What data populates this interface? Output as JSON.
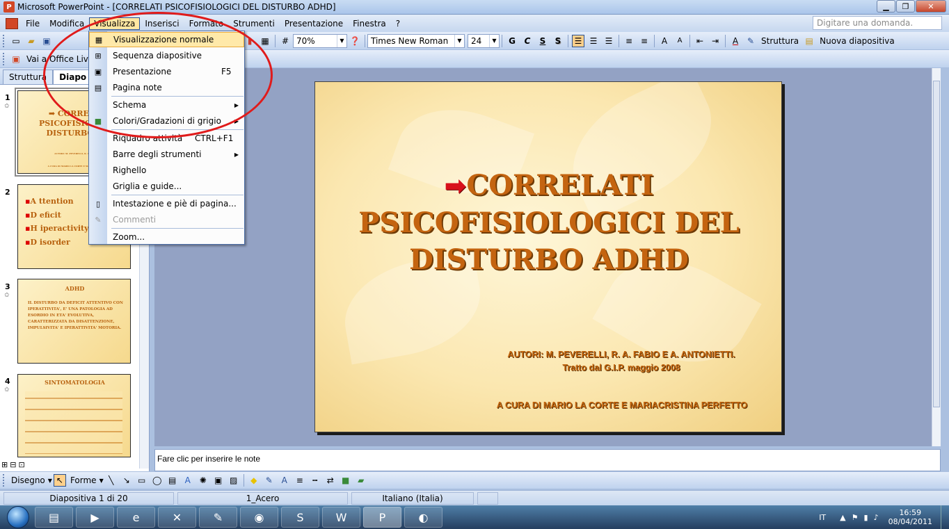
{
  "window": {
    "title": "Microsoft PowerPoint - [CORRELATI PSICOFISIOLOGICI DEL DISTURBO ADHD]",
    "minimize": "▁",
    "restore": "❐",
    "close": "✕"
  },
  "menubar": {
    "items": [
      "File",
      "Modifica",
      "Visualizza",
      "Inserisci",
      "Formato",
      "Strumenti",
      "Presentazione",
      "Finestra",
      "?"
    ],
    "help_placeholder": "Digitare una domanda."
  },
  "toolbar_standard": {
    "zoom": "70%",
    "font_name": "Times New Roman",
    "font_size": "24",
    "bold": "G",
    "italic": "C",
    "underline": "S",
    "shadow": "S",
    "structure_label": "Struttura",
    "new_slide_label": "Nuova diapositiva"
  },
  "toolbar_web": {
    "office_live": "Vai a Office Live"
  },
  "left_panel": {
    "tabs": [
      "Struttura",
      "Diapo"
    ],
    "thumbs": [
      {
        "num": "1",
        "title": "➡ CORRELA PSICOFISIOLOG DISTURBO A",
        "sub1": "AUTORI: M. PEVERELLI, R. A. FABIO E A. ANTONIETTI",
        "sub2": "A CURA DI MARIO LA CORTE E MARIACRISTINA PERFETTO"
      },
      {
        "num": "2",
        "lines": [
          "A ttention",
          "D eficit",
          "H iperactivity",
          "D isorder"
        ]
      },
      {
        "num": "3",
        "title": "ADHD",
        "text": "IL DISTURBO DA DEFICIT ATTENTIVO CON IPERATTIVITA', E' UNA PATOLOGIA AD ESORDIO IN ETA' EVOLUTIVA, CARATTERIZZATA DA DISATTENZIONE, IMPULSIVITA' E IPERATTIVITA' MOTORIA."
      },
      {
        "num": "4",
        "title": "SINTOMATOLOGIA"
      }
    ]
  },
  "view_menu": {
    "items": [
      {
        "label": "Visualizzazione normale",
        "shortcut": "",
        "icon": "normal-view-icon"
      },
      {
        "label": "Sequenza diapositive",
        "shortcut": "",
        "icon": "slide-sorter-icon"
      },
      {
        "label": "Presentazione",
        "shortcut": "F5",
        "icon": "slideshow-icon"
      },
      {
        "label": "Pagina note",
        "shortcut": "",
        "icon": "notes-page-icon"
      },
      {
        "label": "Schema",
        "shortcut": "",
        "icon": ""
      },
      {
        "label": "Colori/Gradazioni di grigio",
        "shortcut": "",
        "icon": "color-icon"
      },
      {
        "label": "Riquadro attività",
        "shortcut": "CTRL+F1",
        "icon": ""
      },
      {
        "label": "Barre degli strumenti",
        "shortcut": "",
        "icon": ""
      },
      {
        "label": "Righello",
        "shortcut": "",
        "icon": ""
      },
      {
        "label": "Griglia e guide...",
        "shortcut": "",
        "icon": ""
      },
      {
        "label": "Intestazione e piè di pagina...",
        "shortcut": "",
        "icon": "header-footer-icon"
      },
      {
        "label": "Commenti",
        "shortcut": "",
        "icon": "comments-icon"
      },
      {
        "label": "Zoom...",
        "shortcut": "",
        "icon": ""
      }
    ]
  },
  "slide": {
    "title_line1": "CORRELATI",
    "title_line2": "PSICOFISIOLOGICI DEL",
    "title_line3": "DISTURBO ADHD",
    "arrow": "➡",
    "authors_line1": "AUTORI: M. PEVERELLI, R. A. FABIO E A. ANTONIETTI.",
    "authors_line2": "Tratto dal G.I.P. maggio 2008",
    "cura": "A CURA  DI MARIO LA CORTE E MARIACRISTINA PERFETTO"
  },
  "notes": {
    "placeholder": "Fare clic per inserire le note"
  },
  "drawbar": {
    "draw": "Disegno",
    "shapes": "Forme"
  },
  "statusbar": {
    "slide_info": "Diapositiva 1 di 20",
    "design": "1_Acero",
    "language": "Italiano (Italia)"
  },
  "taskbar": {
    "lang": "IT",
    "time": "16:59",
    "date": "08/04/2011"
  }
}
